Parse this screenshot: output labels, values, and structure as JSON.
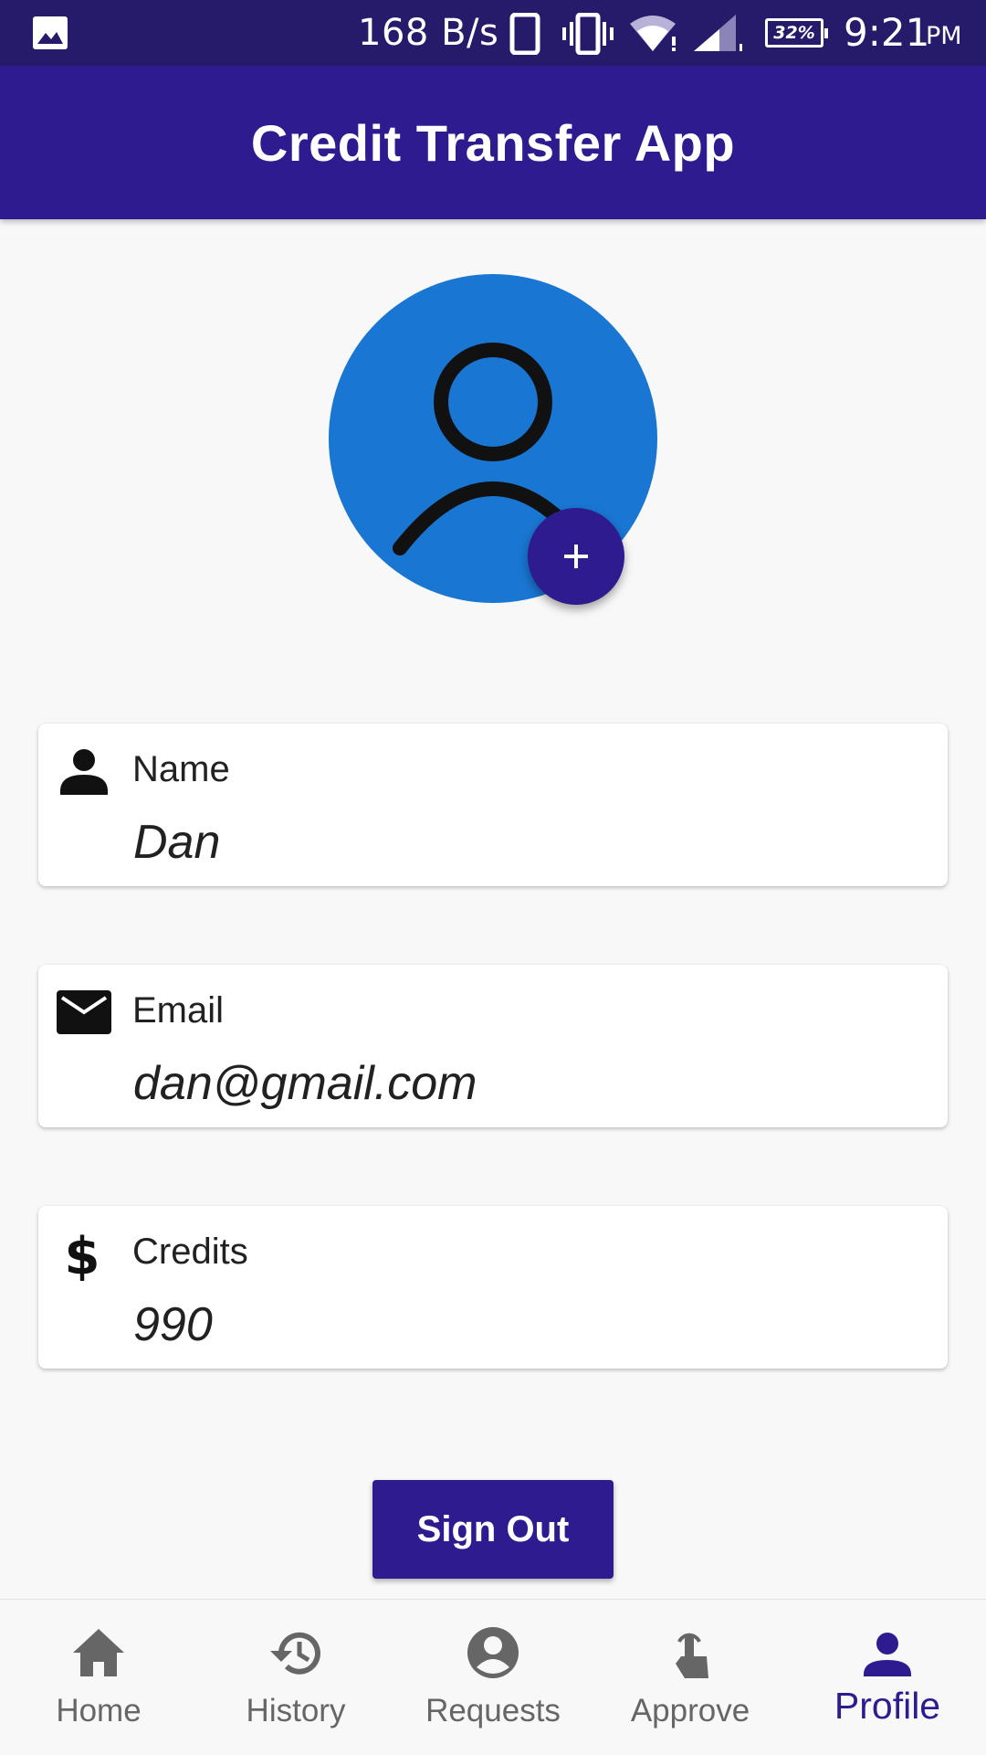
{
  "status_bar": {
    "net_speed": "168 B/s",
    "battery": "32%",
    "time": "9:21",
    "ampm": "PM"
  },
  "app_bar": {
    "title": "Credit Transfer App"
  },
  "avatar": {
    "add_button_label": "+"
  },
  "profile": {
    "name": {
      "label": "Name",
      "value": "Dan",
      "icon": "person-icon"
    },
    "email": {
      "label": "Email",
      "value": "dan@gmail.com",
      "icon": "mail-icon"
    },
    "credits": {
      "label": "Credits",
      "value": "990",
      "icon": "dollar-icon"
    }
  },
  "sign_out_label": "Sign Out",
  "bottom_nav": {
    "items": [
      {
        "label": "Home",
        "icon": "home-icon"
      },
      {
        "label": "History",
        "icon": "history-icon"
      },
      {
        "label": "Requests",
        "icon": "account-circle-icon"
      },
      {
        "label": "Approve",
        "icon": "touch-icon"
      },
      {
        "label": "Profile",
        "icon": "person-icon"
      }
    ],
    "active": "Profile"
  },
  "colors": {
    "primary": "#2e1b90",
    "status_bar": "#261a6b",
    "avatar_bg": "#1976d2",
    "nav_inactive": "#666666"
  }
}
